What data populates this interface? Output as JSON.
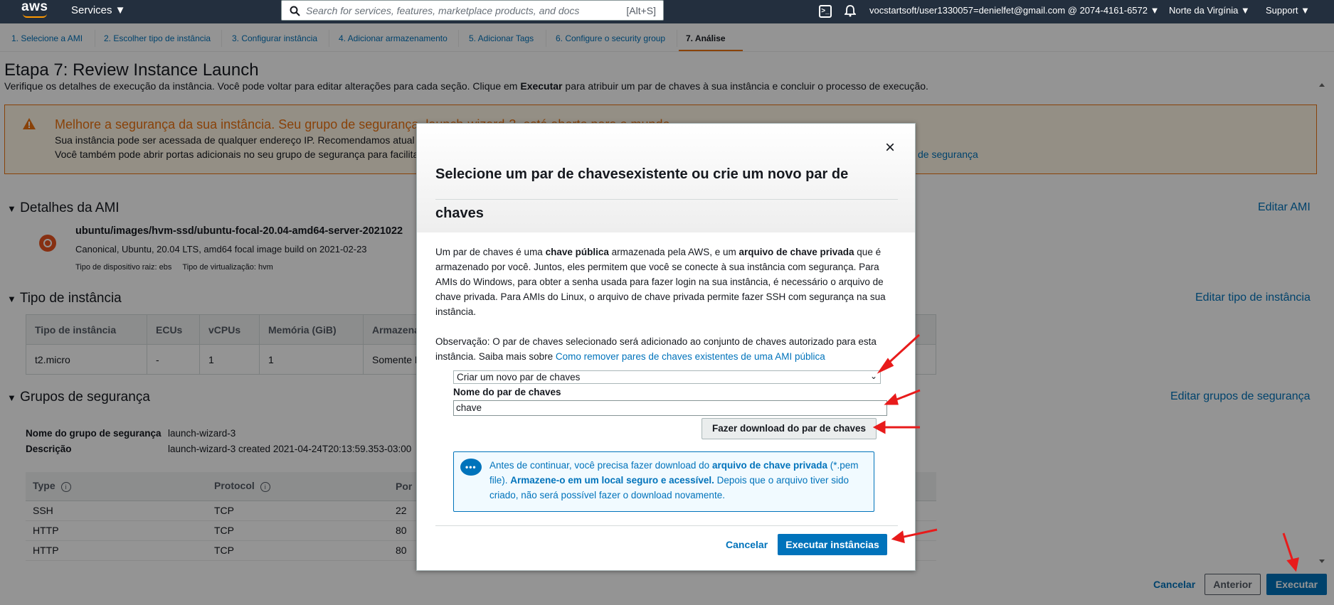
{
  "nav": {
    "logo": "aws",
    "services": "Services ▼",
    "search_placeholder": "Search for services, features, marketplace products, and docs",
    "search_shortcut": "[Alt+S]",
    "account": "vocstartsoft/user1330057=denielfet@gmail.com @ 2074-4161-6572 ▼",
    "region": "Norte da Virgínia ▼",
    "support": "Support ▼"
  },
  "steps": [
    "1. Selecione a AMI",
    "2. Escolher tipo de instância",
    "3. Configurar instância",
    "4. Adicionar armazenamento",
    "5. Adicionar Tags",
    "6. Configure o security group",
    "7. Análise"
  ],
  "page": {
    "title": "Etapa 7: Review Instance Launch",
    "subtitle_pre": "Verifique os detalhes de execução da instância. Você pode voltar para editar alterações para cada seção. Clique em ",
    "subtitle_bold": "Executar",
    "subtitle_post": " para atribuir um par de chaves à sua instância e concluir o processo de execução."
  },
  "warning": {
    "title": "Melhore a segurança da sua instância. Seu grupo de segurança, launch-wizard-3, está aberto para o mundo.",
    "line1": "Sua instância pode ser acessada de qualquer endereço IP. Recomendamos atual",
    "line2": "Você também pode abrir portas adicionais no seu grupo de segurança para facilita",
    "link": "de segurança"
  },
  "ami": {
    "section": "Detalhes da AMI",
    "edit": "Editar AMI",
    "name": "ubuntu/images/hvm-ssd/ubuntu-focal-20.04-amd64-server-2021022",
    "desc": "Canonical, Ubuntu, 20.04 LTS, amd64 focal image build on 2021-02-23",
    "meta": "Tipo de dispositivo raiz: ebs     Tipo de virtualização: hvm"
  },
  "instance_type": {
    "section": "Tipo de instância",
    "edit": "Editar tipo de instância",
    "headers": [
      "Tipo de instância",
      "ECUs",
      "vCPUs",
      "Memória (GiB)",
      "Armazena"
    ],
    "row": [
      "t2.micro",
      "-",
      "1",
      "1",
      "Somente E"
    ]
  },
  "security": {
    "section": "Grupos de segurança",
    "edit": "Editar grupos de segurança",
    "name_label": "Nome do grupo de segurança",
    "name_value": "launch-wizard-3",
    "desc_label": "Descrição",
    "desc_value": "launch-wizard-3 created 2021-04-24T20:13:59.353-03:00",
    "headers": [
      "Type",
      "Protocol",
      "Por"
    ],
    "rows": [
      [
        "SSH",
        "TCP",
        "22"
      ],
      [
        "HTTP",
        "TCP",
        "80"
      ],
      [
        "HTTP",
        "TCP",
        "80"
      ]
    ]
  },
  "footer": {
    "cancel": "Cancelar",
    "previous": "Anterior",
    "launch": "Executar"
  },
  "modal": {
    "title": "Selecione um par de chavesexistente ou crie um novo par de chaves",
    "close": "×",
    "body_1": "Um par de chaves é uma ",
    "body_b1": "chave pública",
    "body_2": " armazenada pela AWS, e um ",
    "body_b2": "arquivo de chave privada",
    "body_3": " que é armazenado por você. Juntos, eles permitem que você se conecte à sua instância com segurança. Para AMIs do Windows, para obter a senha usada para fazer login na sua instância, é necessário o arquivo de chave privada. Para AMIs do Linux, o arquivo de chave privada permite fazer SSH com segurança na sua instância.",
    "note": "Observação: O par de chaves selecionado será adicionado ao conjunto de chaves autorizado para esta instância. Saiba mais sobre ",
    "note_link": "Como remover pares de chaves existentes de uma AMI pública",
    "select_value": "Criar um novo par de chaves",
    "keyname_label": "Nome do par de chaves",
    "keyname_value": "chave",
    "download": "Fazer download do par de chaves",
    "info_1": "Antes de continuar, você precisa fazer download do ",
    "info_b1": "arquivo de chave privada",
    "info_2": " (*.pem file). ",
    "info_b2": "Armazene-o em um local seguro e acessível.",
    "info_3": " Depois que o arquivo tiver sido criado, não será possível fazer o download novamente.",
    "cancel": "Cancelar",
    "launch": "Executar instâncias"
  },
  "colors": {
    "accent": "#0073bb",
    "warning": "#ec7211",
    "nav": "#232f3e",
    "annotation": "#e81b1b"
  }
}
